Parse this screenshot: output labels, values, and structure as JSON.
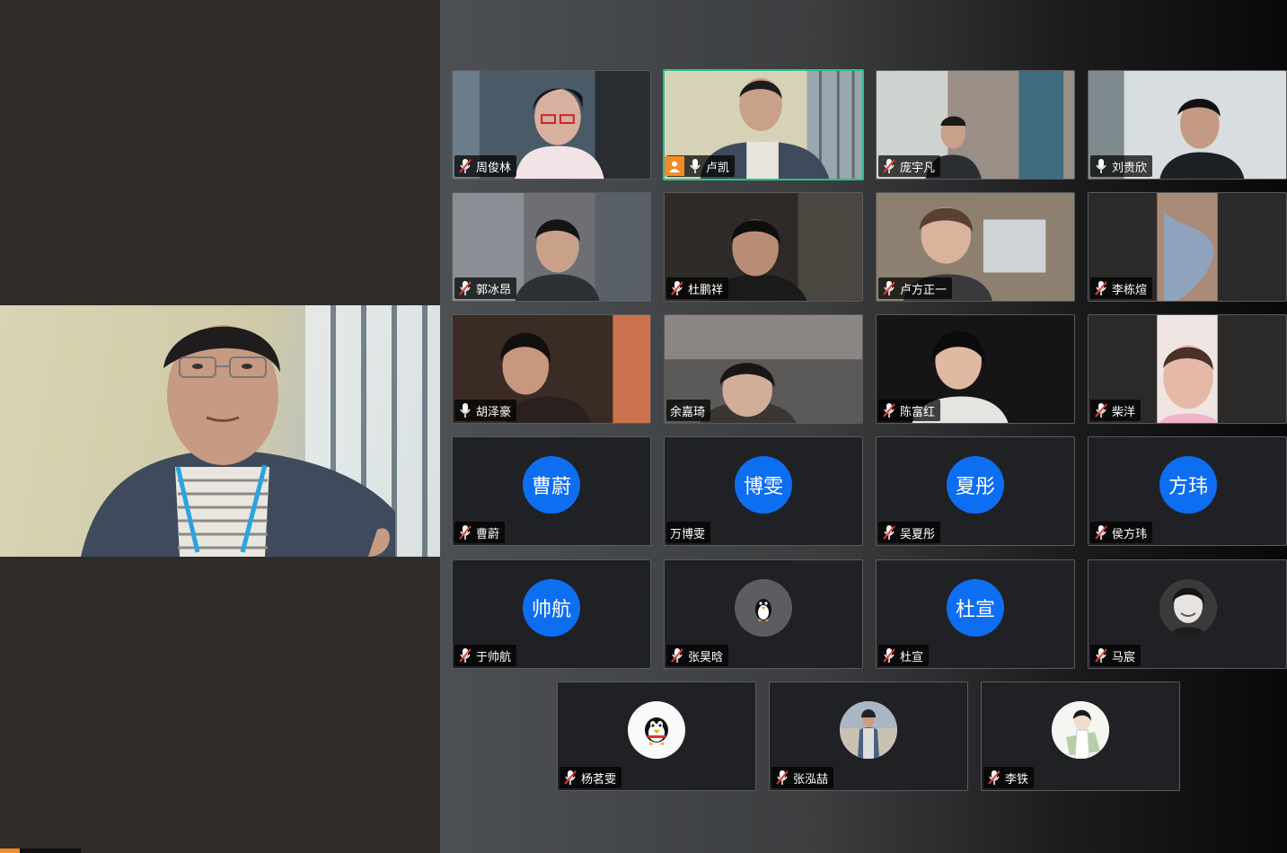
{
  "meeting": {
    "accent_color": "#f28c28",
    "active_speaker_border": "#27c28a",
    "avatar_blue": "#0d6ef2"
  },
  "participants": [
    {
      "name": "周俊林",
      "mic": "muted",
      "video": true
    },
    {
      "name": "卢凯",
      "mic": "on",
      "video": true,
      "host": true,
      "speaking": true
    },
    {
      "name": "庞宇凡",
      "mic": "muted",
      "video": true
    },
    {
      "name": "刘贵欣",
      "mic": "on",
      "video": true
    },
    {
      "name": "郭冰昂",
      "mic": "muted",
      "video": true
    },
    {
      "name": "杜鹏祥",
      "mic": "muted",
      "video": true
    },
    {
      "name": "卢方正一",
      "mic": "muted",
      "video": true
    },
    {
      "name": "李栋煊",
      "mic": "muted",
      "video": true
    },
    {
      "name": "胡泽豪",
      "mic": "on",
      "video": true
    },
    {
      "name": "余嘉琦",
      "mic": "none",
      "video": true
    },
    {
      "name": "陈富红",
      "mic": "muted",
      "video": true
    },
    {
      "name": "柴洋",
      "mic": "muted",
      "video": true
    },
    {
      "name": "曹蔚",
      "mic": "muted",
      "avatar_text": "曹蔚"
    },
    {
      "name": "万博雯",
      "mic": "none",
      "avatar_text": "博雯"
    },
    {
      "name": "吴夏彤",
      "mic": "muted",
      "avatar_text": "夏彤"
    },
    {
      "name": "侯方玮",
      "mic": "muted",
      "avatar_text": "方玮"
    },
    {
      "name": "于帅航",
      "mic": "muted",
      "avatar_text": "帅航"
    },
    {
      "name": "张昊晗",
      "mic": "muted",
      "avatar_icon": "penguin-icon"
    },
    {
      "name": "杜宣",
      "mic": "muted",
      "avatar_text": "杜宣"
    },
    {
      "name": "马宸",
      "mic": "muted",
      "avatar_icon": "portrait-icon"
    },
    {
      "name": "杨茗雯",
      "mic": "muted",
      "avatar_icon": "penguin-icon"
    },
    {
      "name": "张泓喆",
      "mic": "muted",
      "avatar_icon": "portrait-icon"
    },
    {
      "name": "李铁",
      "mic": "muted",
      "avatar_icon": "portrait-icon"
    }
  ]
}
